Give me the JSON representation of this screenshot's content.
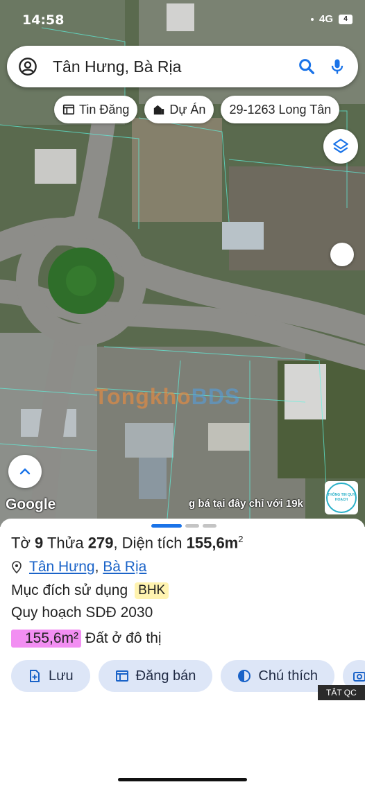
{
  "status_bar": {
    "time": "14:58",
    "network": "4G",
    "battery": "4"
  },
  "search": {
    "query": "Tân Hưng, Bà Rịa"
  },
  "chips": [
    {
      "label": "Tin Đăng",
      "icon": "listing-icon"
    },
    {
      "label": "Dự Án",
      "icon": "project-icon"
    },
    {
      "label": "29-1263 Long Tân",
      "icon": ""
    }
  ],
  "map": {
    "attribution": "Google",
    "ticker": "g bá tại đây chỉ với 19k",
    "watermark_a": "Tongkho",
    "watermark_b": "BDS",
    "plan_logo": "THÔNG TIN QUY HOẠCH"
  },
  "parcel": {
    "sheet_label": "Tờ",
    "sheet_no": "9",
    "plot_label": "Thửa",
    "plot_no": "279",
    "area_label": ", Diện tích",
    "area_value": "155,6m",
    "area_unit_sup": "2",
    "ward": "Tân Hưng",
    "city": "Bà Rịa",
    "purpose_label": "Mục đích sử dụng",
    "purpose_code": "BHK",
    "plan_title": "Quy hoạch SDĐ 2030",
    "land_badge": "155,6m²",
    "land_type": "Đất ở đô thị"
  },
  "actions": [
    {
      "label": "Lưu",
      "icon": "save-icon"
    },
    {
      "label": "Đăng bán",
      "icon": "post-sale-icon"
    },
    {
      "label": "Chú thích",
      "icon": "legend-icon"
    }
  ],
  "ad_tag": "TẮT QC",
  "colors": {
    "accent": "#1a73e8",
    "chip_bg": "#dde6f7",
    "land_badge": "#f28ef2",
    "purpose_badge": "#fff3b0"
  }
}
